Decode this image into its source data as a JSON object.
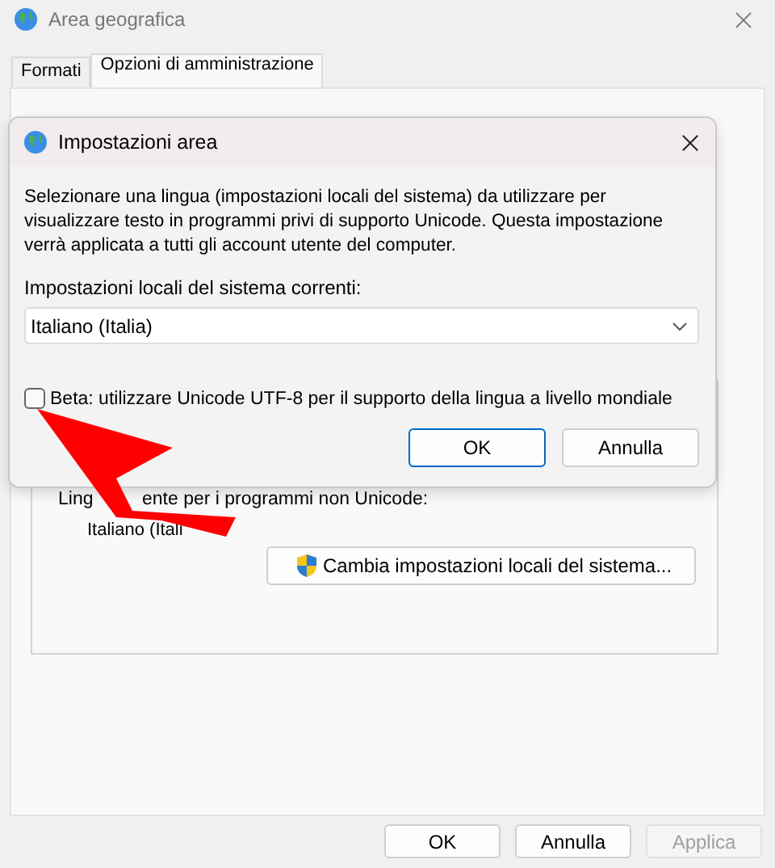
{
  "window": {
    "title": "Area geografica"
  },
  "tabs": [
    {
      "label": "Formati",
      "selected": false
    },
    {
      "label": "Opzioni di amministrazione",
      "selected": true
    }
  ],
  "group": {
    "label_parts": [
      "Ling",
      "ente per i programmi non Unicode:"
    ],
    "value": "Italiano (Itali",
    "button": "Cambia impostazioni locali del sistema..."
  },
  "buttons": [
    {
      "label": "OK",
      "disabled": false
    },
    {
      "label": "Annulla",
      "disabled": false
    },
    {
      "label": "Applica",
      "disabled": true
    }
  ],
  "dialog": {
    "title": "Impostazioni area",
    "description": "Selezionare una lingua (impostazioni locali del sistema) da utilizzare per visualizzare testo in programmi privi di supporto Unicode. Questa impostazione verrà applicata a tutti gli account utente del computer.",
    "field_label": "Impostazioni locali del sistema correnti:",
    "select": {
      "value": "Italiano (Italia)"
    },
    "checkbox": {
      "label": "Beta: utilizzare Unicode UTF-8 per il supporto della lingua a livello mondiale",
      "checked": false
    },
    "buttons": [
      {
        "label": "OK",
        "default": true
      },
      {
        "label": "Annulla",
        "default": false
      }
    ]
  }
}
